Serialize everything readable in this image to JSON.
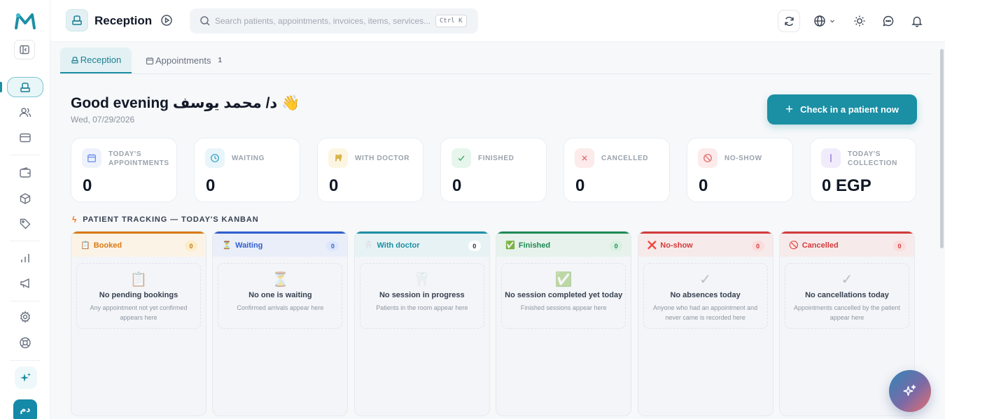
{
  "sidebar": {
    "avatar_initials": "دم",
    "icons": [
      "logo-icon",
      "collapse-icon",
      "reception-icon",
      "patients-icon",
      "billing-icon",
      "wallet-icon",
      "package-icon",
      "tag-icon",
      "reports-icon",
      "megaphone-icon",
      "settings-icon",
      "support-icon",
      "sparkle-icon"
    ]
  },
  "topbar": {
    "title": "Reception",
    "search_placeholder": "Search patients, appointments, invoices, items, services...",
    "shortcut": "Ctrl K"
  },
  "tabs": [
    {
      "label": "Reception",
      "active": true
    },
    {
      "label": "Appointments",
      "count": "1",
      "active": false
    }
  ],
  "header": {
    "greeting": "Good evening د/ محمد يوسف 👋",
    "date": "Wed, 07/29/2026",
    "checkin_label": "Check in a patient now"
  },
  "stats": [
    {
      "label": "TODAY'S APPOINTMENTS",
      "value": "0",
      "icon": "calendar-icon",
      "color": "#6b8ee8",
      "bg": "#eef2fd"
    },
    {
      "label": "WAITING",
      "value": "0",
      "icon": "clock-icon",
      "color": "#3ba3c4",
      "bg": "#e8f5fa"
    },
    {
      "label": "WITH DOCTOR",
      "value": "0",
      "icon": "tooth-icon",
      "color": "#d9b24a",
      "bg": "#fcf5e2"
    },
    {
      "label": "FINISHED",
      "value": "0",
      "icon": "check-icon",
      "color": "#3fa66b",
      "bg": "#e7f6ed"
    },
    {
      "label": "CANCELLED",
      "value": "0",
      "icon": "x-icon",
      "color": "#e06b6b",
      "bg": "#fdeaea"
    },
    {
      "label": "NO-SHOW",
      "value": "0",
      "icon": "ban-icon",
      "color": "#e06b6b",
      "bg": "#fdeaea"
    },
    {
      "label": "TODAY'S COLLECTION",
      "value": "0 EGP",
      "icon": "dollar-icon",
      "color": "#8c6bd9",
      "bg": "#f1ecfc"
    }
  ],
  "kanban": {
    "title": "PATIENT TRACKING — TODAY'S KANBAN",
    "columns": [
      {
        "name": "Booked",
        "glyph": "📋",
        "count": "0",
        "color": "#d97a14",
        "head_bg": "#fbf3e6",
        "badge_bg": "#fdecc8",
        "badge_color": "#b7791f",
        "empty_glyph": "📋",
        "empty_title": "No pending bookings",
        "empty_desc": "Any appointment not yet confirmed appears here"
      },
      {
        "name": "Waiting",
        "glyph": "⏳",
        "count": "0",
        "color": "#2f5fd0",
        "head_bg": "#e9eef9",
        "badge_bg": "#dde7fb",
        "badge_color": "#2f5fd0",
        "empty_glyph": "⏳",
        "empty_title": "No one is waiting",
        "empty_desc": "Confirmed arrivals appear here"
      },
      {
        "name": "With doctor",
        "glyph": "🦷",
        "count": "0",
        "color": "#1b8fa4",
        "head_bg": "#e7f2f5",
        "badge_bg": "#ffffff",
        "badge_color": "#1f2937",
        "empty_glyph": "🦷",
        "empty_title": "No session in progress",
        "empty_desc": "Patients in the room appear here"
      },
      {
        "name": "Finished",
        "glyph": "✅",
        "count": "0",
        "color": "#1f8a55",
        "head_bg": "#e6f2eb",
        "badge_bg": "#d7f0e0",
        "badge_color": "#1f8a55",
        "empty_glyph": "✅",
        "empty_title": "No session completed yet today",
        "empty_desc": "Finished sessions appear here"
      },
      {
        "name": "No-show",
        "glyph": "❌",
        "count": "0",
        "color": "#d23b3b",
        "head_bg": "#f7eaea",
        "badge_bg": "#fbdcdc",
        "badge_color": "#d23b3b",
        "empty_glyph": "✓",
        "empty_title": "No absences today",
        "empty_desc": "Anyone who had an appointment and never came is recorded here"
      },
      {
        "name": "Cancelled",
        "glyph": "🚫",
        "count": "0",
        "color": "#d23b3b",
        "head_bg": "#f7eaea",
        "badge_bg": "#fbdcdc",
        "badge_color": "#d23b3b",
        "empty_glyph": "✓",
        "empty_title": "No cancellations today",
        "empty_desc": "Appointments cancelled by the patient appear here"
      }
    ]
  },
  "colors": {
    "accent": "#1b8fa4"
  }
}
